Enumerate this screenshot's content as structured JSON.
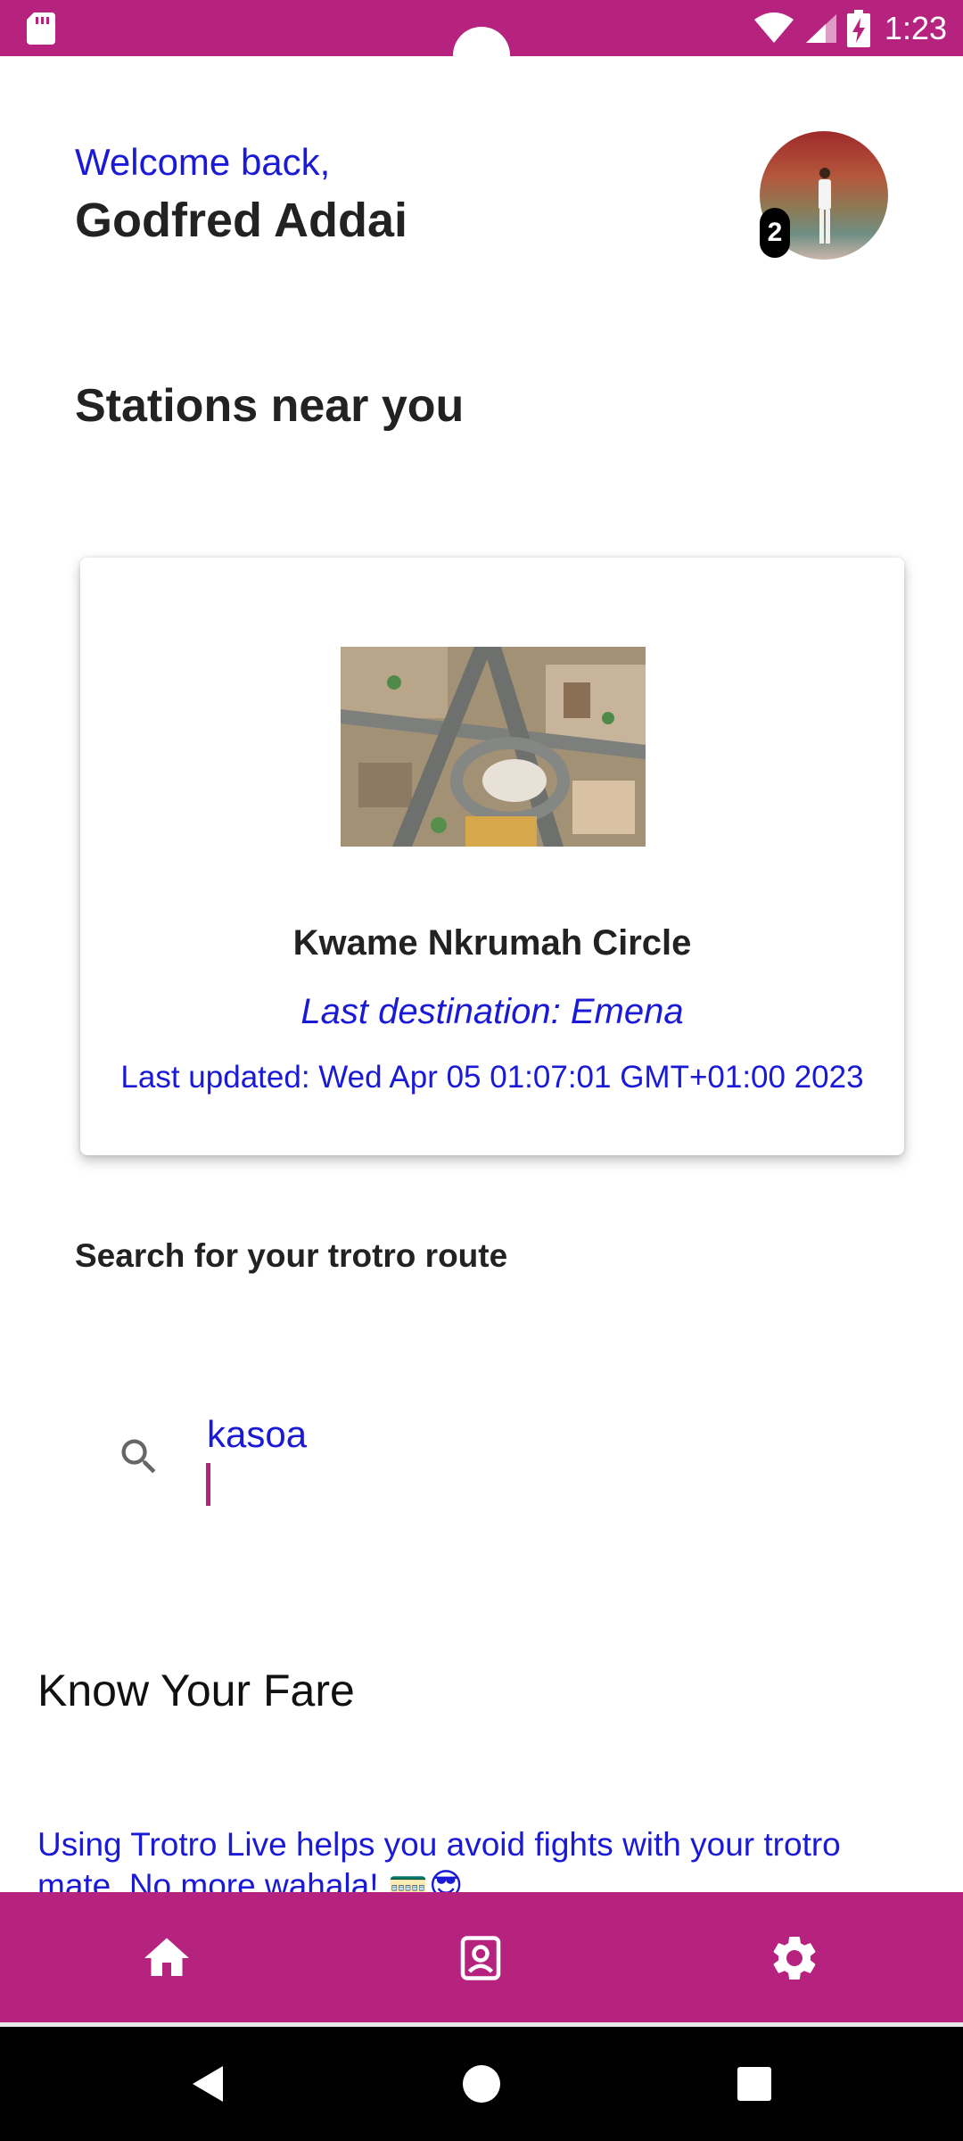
{
  "status_bar": {
    "time": "1:23",
    "icons": [
      "sd-card-icon",
      "wifi-icon",
      "signal-icon",
      "battery-charging-icon"
    ],
    "color": "#b5237f"
  },
  "header": {
    "greeting": "Welcome back,",
    "user_name": "Godfred Addai",
    "notification_count": "2"
  },
  "stations": {
    "title": "Stations near you",
    "card": {
      "name": "Kwame Nkrumah Circle",
      "last_destination": "Last destination: Emena",
      "last_updated": "Last updated: Wed Apr 05 01:07:01 GMT+01:00 2023"
    }
  },
  "search": {
    "label": "Search for your trotro route",
    "value": "kasoa"
  },
  "fare": {
    "title": "Know Your Fare",
    "description": "Using Trotro Live helps you avoid fights with your trotro mate. No more wahala! 🚃😎"
  },
  "bottom_nav": {
    "items": [
      "home-icon",
      "profile-icon",
      "settings-icon"
    ]
  },
  "system_nav": {
    "buttons": [
      "back-icon",
      "home-circle-icon",
      "recent-apps-icon"
    ]
  },
  "colors": {
    "accent": "#b5237f",
    "link_text": "#1a1ad6"
  }
}
